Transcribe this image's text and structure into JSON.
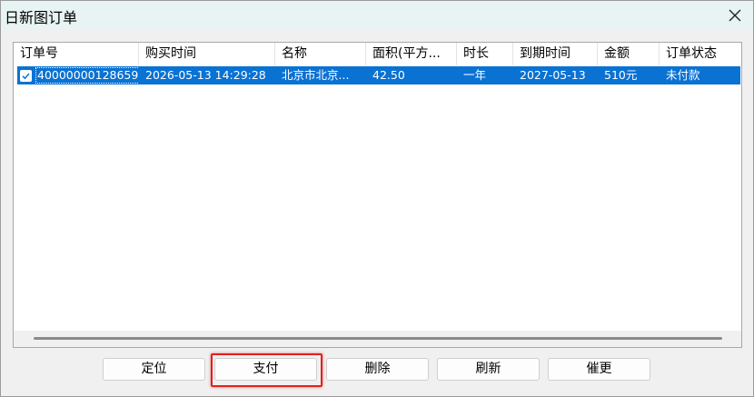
{
  "window": {
    "title": "日新图订单"
  },
  "list": {
    "columns": [
      "订单号",
      "购买时间",
      "名称",
      "面积(平方...",
      "时长",
      "到期时间",
      "金额",
      "订单状态"
    ],
    "rows": [
      {
        "checked": true,
        "selected": true,
        "cells": [
          "40000000128659",
          "2026-05-13 14:29:28",
          "北京市北京...",
          "42.50",
          "一年",
          "2027-05-13",
          "510元",
          "未付款"
        ]
      }
    ]
  },
  "buttons": {
    "locate": "定位",
    "pay": "支付",
    "delete": "删除",
    "refresh": "刷新",
    "update": "催更"
  },
  "colors": {
    "selection": "#0a72d3",
    "highlight_box": "#e0201c",
    "titlebar": "#e8f4f4"
  }
}
